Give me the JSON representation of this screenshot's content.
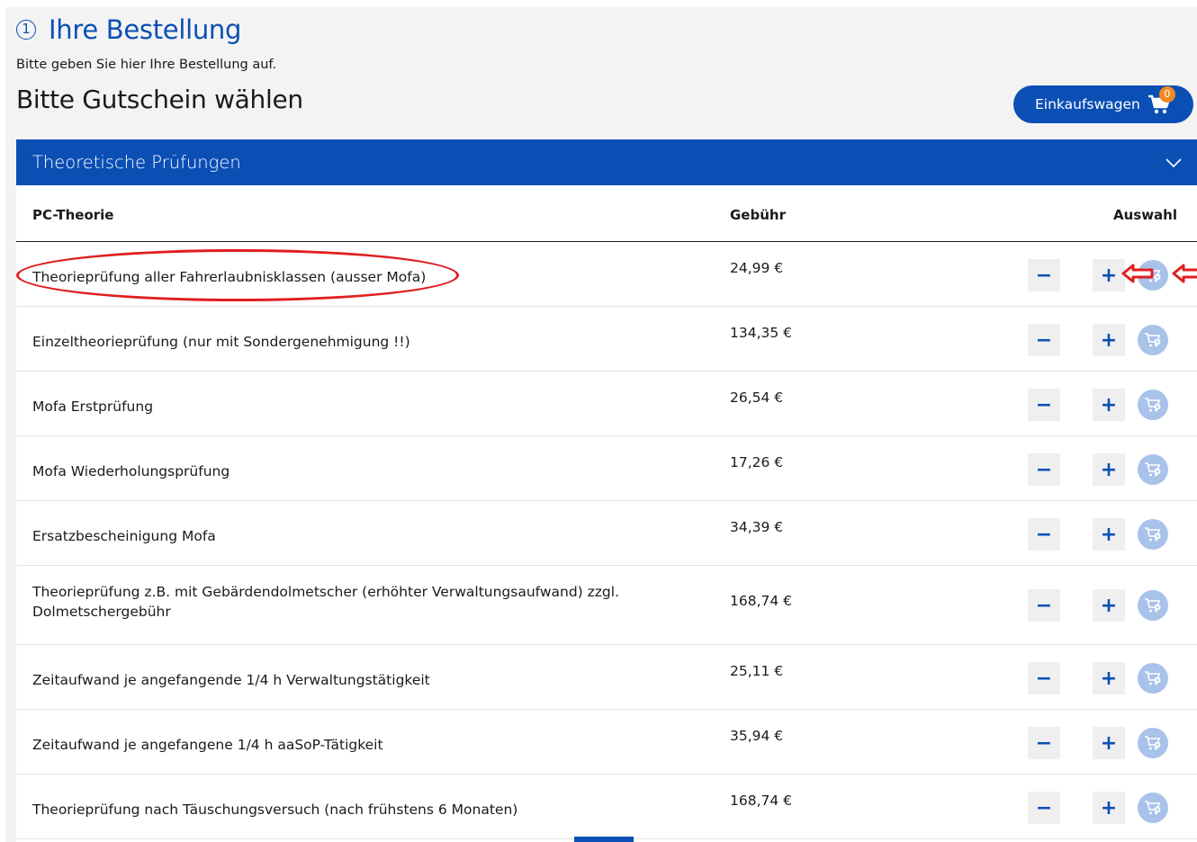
{
  "step": {
    "number": "1",
    "title": "Ihre Bestellung",
    "subtitle": "Bitte geben Sie hier Ihre Bestellung auf."
  },
  "voucher_heading": "Bitte Gutschein wählen",
  "cart": {
    "label": "Einkaufswagen",
    "count": "0"
  },
  "section": {
    "title": "Theoretische Prüfungen"
  },
  "table": {
    "headers": {
      "name": "PC-Theorie",
      "fee": "Gebühr",
      "select": "Auswahl"
    },
    "rows": [
      {
        "name": "Theorieprüfung aller Fahrerlaubnisklassen (ausser Mofa)",
        "fee": "24,99 €"
      },
      {
        "name": "Einzeltheorieprüfung (nur mit Sondergenehmigung !!)",
        "fee": "134,35 €"
      },
      {
        "name": "Mofa Erstprüfung",
        "fee": "26,54 €"
      },
      {
        "name": "Mofa Wiederholungsprüfung",
        "fee": "17,26 €"
      },
      {
        "name": "Ersatzbescheinigung Mofa",
        "fee": "34,39 €"
      },
      {
        "name": "Theorieprüfung z.B. mit Gebärdendolmetscher (erhöhter Verwaltungsaufwand) zzgl. Dolmetschergebühr",
        "fee": "168,74 €"
      },
      {
        "name": "Zeitaufwand je angefangende 1/4 h Verwaltungstätigkeit",
        "fee": "25,11 €"
      },
      {
        "name": "Zeitaufwand je angefangene 1/4 h aaSoP-Tätigkeit",
        "fee": "35,94 €"
      },
      {
        "name": "Theorieprüfung nach Täuschungsversuch (nach frühstens 6 Monaten)",
        "fee": "168,74 €"
      }
    ]
  },
  "controls": {
    "minus": "−",
    "plus": "+",
    "qty_value": ""
  },
  "colors": {
    "primary": "#0b4fb5",
    "badge": "#f08a24",
    "annotation": "#e01e1e",
    "add_cart_disabled": "#a9c2ea"
  },
  "icons": {
    "cart": "cart-icon",
    "add_to_cart": "cart-add-icon",
    "chevron": "chevron-down-icon"
  }
}
